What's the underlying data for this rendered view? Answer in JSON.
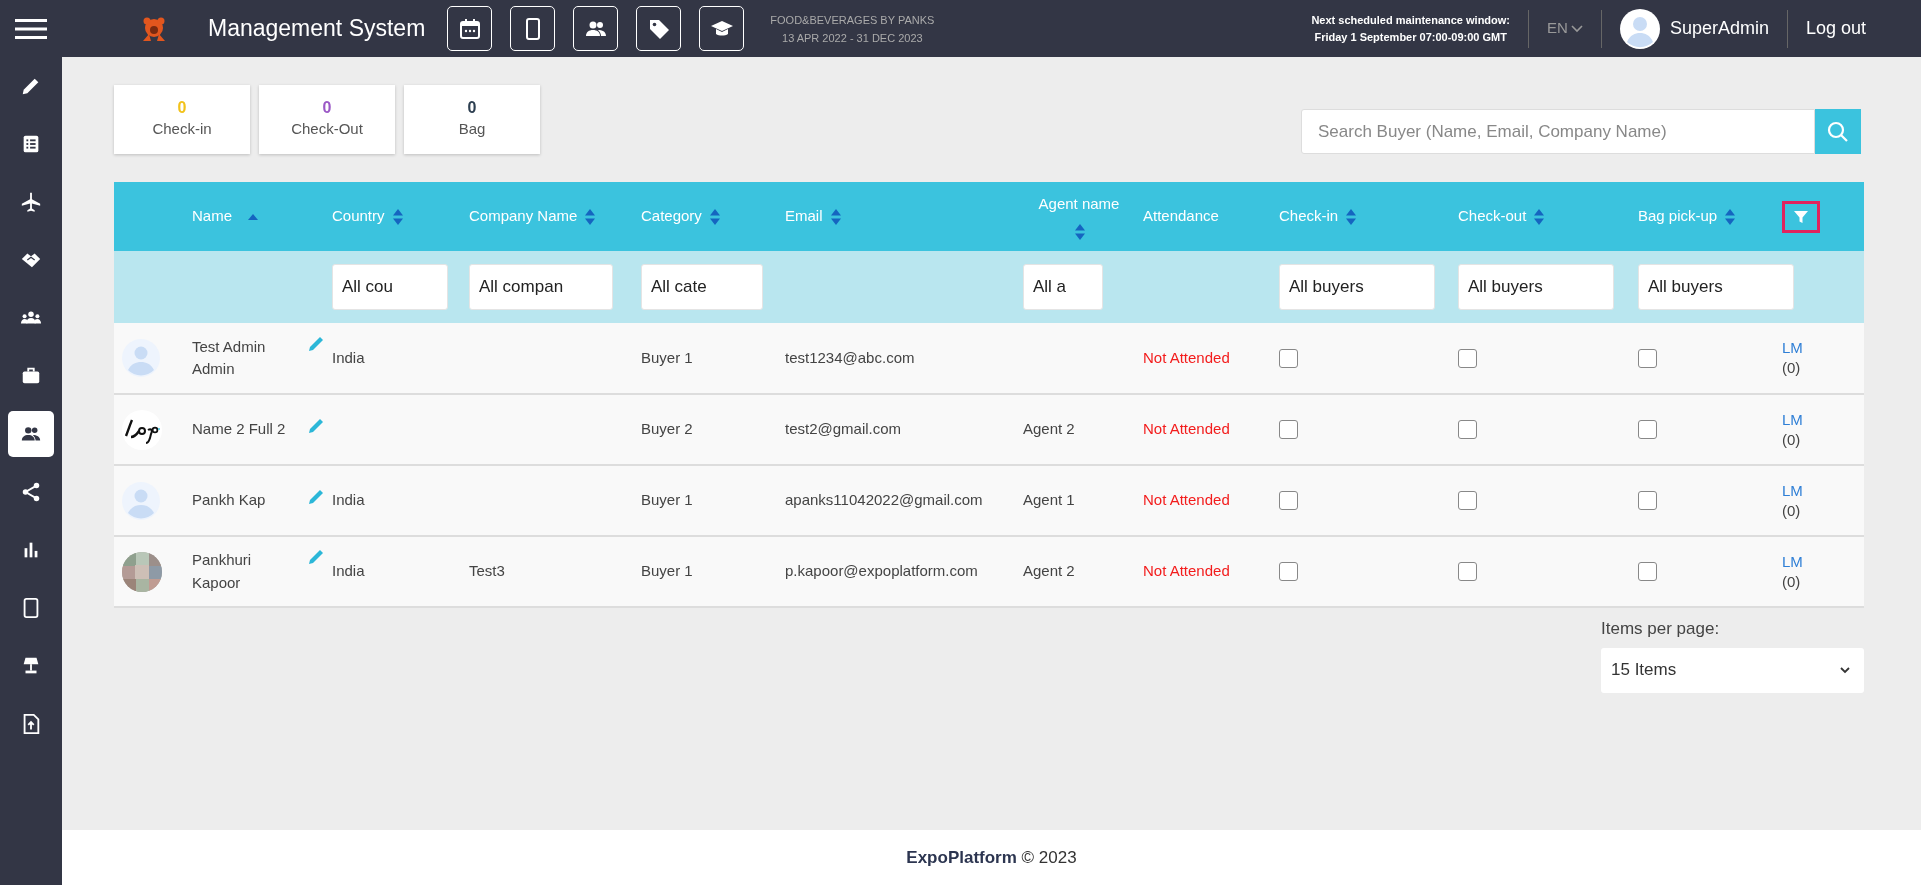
{
  "topbar": {
    "title": "Management System",
    "event_name": "FOOD&BEVERAGES BY PANKS",
    "event_dates": "13 APR 2022 - 31 DEC 2023",
    "maintenance_label": "Next scheduled maintenance window:",
    "maintenance_time": "Friday 1 September 07:00-09:00 GMT",
    "language": "EN",
    "user_name": "SuperAdmin",
    "logout": "Log out"
  },
  "sidebar": {
    "items": [
      {
        "selected": false
      },
      {
        "selected": false
      },
      {
        "selected": false
      },
      {
        "selected": false
      },
      {
        "selected": false
      },
      {
        "selected": false
      },
      {
        "selected": true
      },
      {
        "selected": false
      },
      {
        "selected": false
      },
      {
        "selected": false
      },
      {
        "selected": false
      },
      {
        "selected": false
      }
    ]
  },
  "stats": [
    {
      "value": "0",
      "label": "Check-in",
      "color": "#f2c21b"
    },
    {
      "value": "0",
      "label": "Check-Out",
      "color": "#9b59c6"
    },
    {
      "value": "0",
      "label": "Bag",
      "color": "#2c3e50"
    }
  ],
  "search": {
    "placeholder": "Search Buyer (Name, Email, Company Name)"
  },
  "table": {
    "columns": [
      {
        "label": "Name",
        "sorted": true
      },
      {
        "label": "Country",
        "sortable": true,
        "sorted": false,
        "filter": "All cou"
      },
      {
        "label": "Company Name",
        "sortable": true,
        "sorted": false,
        "filter": "All compan"
      },
      {
        "label": "Category",
        "sortable": true,
        "sorted": false,
        "filter": "All cate"
      },
      {
        "label": "Email",
        "sortable": true,
        "sorted": false
      },
      {
        "label": "Agent name",
        "sortable": true,
        "sorted": false,
        "filter": "All a"
      },
      {
        "label": "Attendance",
        "sortable": false
      },
      {
        "label": "Check-in",
        "sortable": true,
        "sorted": false,
        "filter": "All buyers"
      },
      {
        "label": "Check-out",
        "sortable": true,
        "sorted": false,
        "filter": "All buyers"
      },
      {
        "label": "Bag pick-up",
        "sortable": true,
        "sorted": false,
        "filter": "All buyers"
      }
    ],
    "filter_button": {
      "highlighted": true
    },
    "rows": [
      {
        "avatar": {
          "kind": "placeholder"
        },
        "name": "Test Admin Admin",
        "country": "India",
        "category": "Buyer 1",
        "email": "test1234@abc.com",
        "attendance": "Not Attended",
        "checkin": false,
        "checkout": false,
        "bag": false,
        "link": "LM",
        "count": "(0)"
      },
      {
        "avatar": {
          "kind": "logo"
        },
        "name": "Name 2 Full 2",
        "category": "Buyer 2",
        "email": "test2@gmail.com",
        "agent": "Agent 2",
        "attendance": "Not Attended",
        "checkin": false,
        "checkout": false,
        "bag": false,
        "link": "LM",
        "count": "(0)"
      },
      {
        "avatar": {
          "kind": "placeholder"
        },
        "name": "Pankh Kap",
        "country": "India",
        "category": "Buyer 1",
        "email": "apanks11042022@gmail.com",
        "agent": "Agent 1",
        "attendance": "Not Attended",
        "checkin": false,
        "checkout": false,
        "bag": false,
        "link": "LM",
        "count": "(0)"
      },
      {
        "name": "Pankhuri Kapoor",
        "country": "India",
        "company": "Test3",
        "category": "Buyer 1",
        "email": "p.kapoor@expoplatform.com",
        "agent": "Agent 2",
        "attendance": "Not Attended",
        "checkin": false,
        "checkout": false,
        "bag": false,
        "link": "LM",
        "count": "(0)"
      }
    ]
  },
  "pagination": {
    "label": "Items per page:",
    "value": "15 Items"
  },
  "footer": "**ExpoPlatform** © 2023"
}
